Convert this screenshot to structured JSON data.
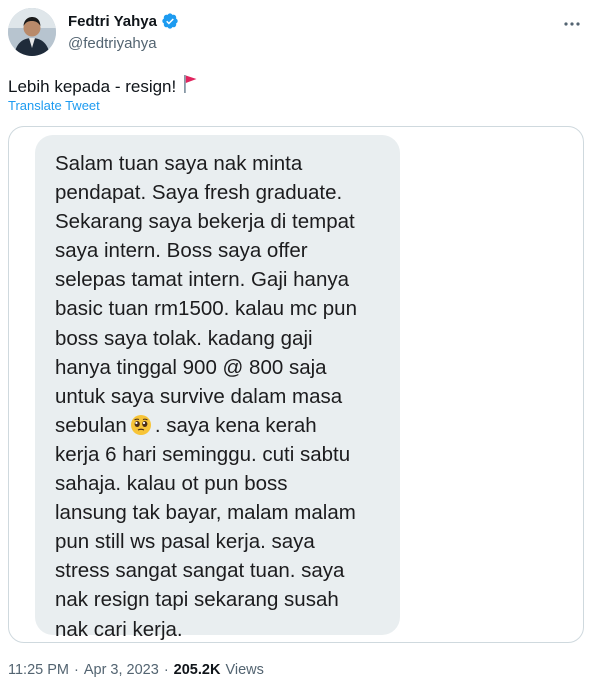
{
  "author": {
    "display_name": "Fedtri Yahya",
    "handle": "@fedtriyahya"
  },
  "tweet": {
    "text": "Lebih kepada - resign!",
    "flag_icon": "red-flag-icon",
    "translate_label": "Translate Tweet"
  },
  "message": {
    "lines": [
      "Salam tuan saya nak minta",
      "pendapat. Saya fresh graduate.",
      "Sekarang saya bekerja di tempat",
      "saya intern. Boss saya offer",
      "selepas tamat intern. Gaji hanya",
      "basic tuan rm1500. kalau mc pun",
      "boss saya tolak. kadang gaji",
      "hanya tinggal 900 @ 800 saja",
      "untuk saya survive dalam masa",
      "sebulan",
      ". saya kena kerah",
      "kerja 6 hari seminggu. cuti sabtu",
      "sahaja. kalau ot pun boss",
      "lansung tak bayar, malam malam",
      "pun still ws pasal kerja. saya",
      "stress sangat sangat tuan. saya",
      "nak resign tapi sekarang susah",
      "nak cari kerja."
    ],
    "emoji_icon": "pleading-face-icon"
  },
  "footer": {
    "time": "11:25 PM",
    "separator": "·",
    "date": "Apr 3, 2023",
    "views_count": "205.2K",
    "views_label": "Views"
  },
  "colors": {
    "link": "#1d9bf0",
    "secondary_text": "#536471",
    "bubble_bg": "#e9eef0",
    "verified": "#1d9bf0",
    "flag": "#e0245e"
  }
}
